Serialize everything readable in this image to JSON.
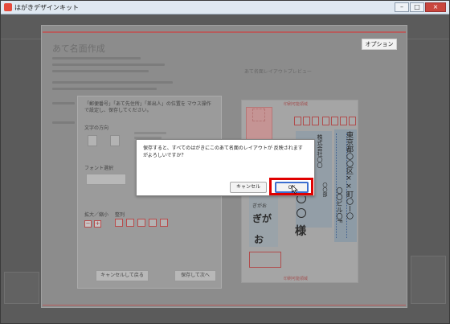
{
  "window": {
    "title": "はがきデザインキット",
    "controls": {
      "minimize": "–",
      "maximize": "□",
      "close": "×"
    }
  },
  "background": {
    "heading": "あて名面作成",
    "option_button": "オプション",
    "preview_label": "あて名面レイアウトプレビュー"
  },
  "inner_panel": {
    "instructions": "「郵便番号」「あて先住所」「差出人」の位置を マウス操作で設定し、保存してください。",
    "text_direction_label": "文字の方向",
    "font_select_label": "フォント選択",
    "zoom_label": "拡大／縮小",
    "align_label": "整列",
    "cancel_button": "キャンセルして戻る",
    "save_button": "保存して次へ"
  },
  "postcard": {
    "top_label": "印刷可能領域",
    "bottom_label": "印刷可能領域",
    "recipient_address": "東京都〇〇区××町〇ー〇",
    "building": "〇〇ビル〇F",
    "company": "株式会社〇〇",
    "department": "〇〇部",
    "name_suffix": "様",
    "sender_name": "ぎがお"
  },
  "dialog": {
    "message": "保存すると、すべてのはがきにこのあて名面のレイアウトが 反映されますがよろしいですか？",
    "cancel_button": "キャンセル",
    "ok_button": "OK"
  },
  "colors": {
    "highlight": "#e00000",
    "ok_focus": "#3c6fd0"
  }
}
